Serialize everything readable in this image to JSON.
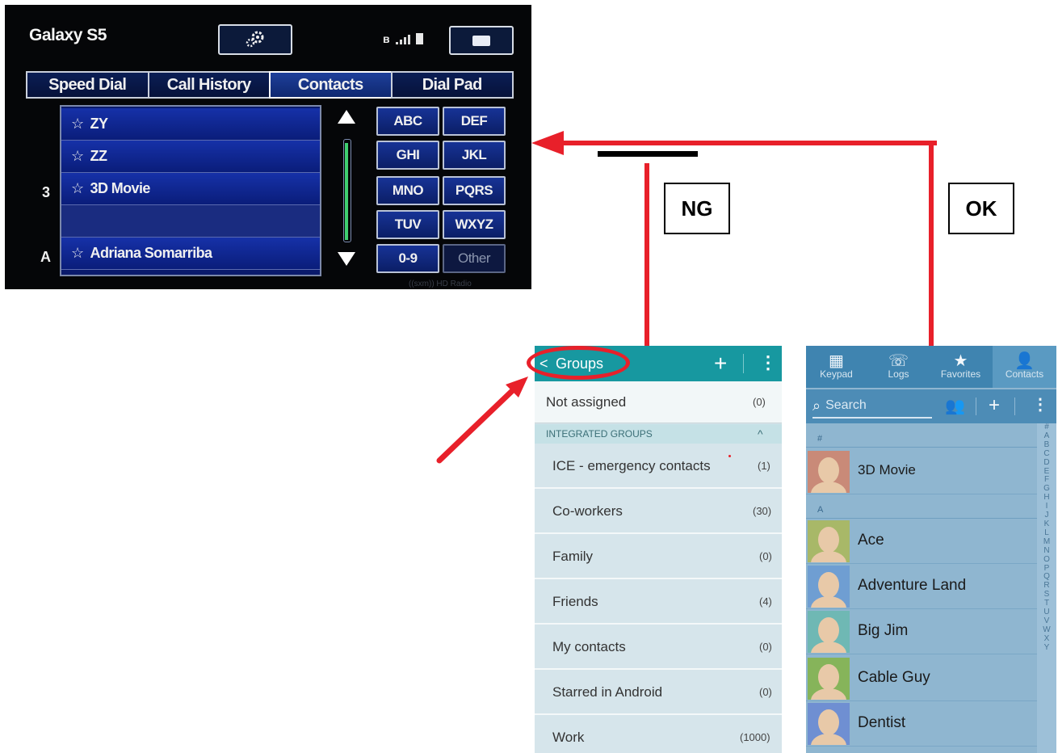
{
  "car_display": {
    "device_name": "Galaxy S5",
    "settings_icon": "gear-icon",
    "status_icons": [
      "bluetooth-icon",
      "signal-bars-icon",
      "battery-icon"
    ],
    "bluetooth_glyph": "ʙ",
    "message_icon": "envelope-icon",
    "tabs": [
      {
        "label": "Speed Dial",
        "active": false
      },
      {
        "label": "Call History",
        "active": false
      },
      {
        "label": "Contacts",
        "active": true
      },
      {
        "label": "Dial Pad",
        "active": false
      }
    ],
    "contact_list": [
      {
        "index": "",
        "star": "☆",
        "name": "ZY"
      },
      {
        "index": "",
        "star": "☆",
        "name": "ZZ"
      },
      {
        "index": "3",
        "star": "☆",
        "name": "3D Movie"
      },
      {
        "index": "",
        "star": "",
        "name": ""
      },
      {
        "index": "A",
        "star": "☆",
        "name": "Adriana Somarriba"
      }
    ],
    "scroll_arrows": [
      "triangle-up-icon",
      "triangle-down-icon"
    ],
    "keypad": [
      [
        "ABC",
        "DEF"
      ],
      [
        "GHI",
        "JKL"
      ],
      [
        "MNO",
        "PQRS"
      ],
      [
        "TUV",
        "WXYZ"
      ],
      [
        "0-9",
        "Other"
      ]
    ],
    "brand_footer": "((sxm)) HD Radio"
  },
  "annotations": {
    "ng_label": "NG",
    "ok_label": "OK",
    "line_color": "#e8202a"
  },
  "groups_screen": {
    "back_glyph": "<",
    "title": "Groups",
    "add_glyph": "+",
    "more_glyph": "⋮",
    "not_assigned": {
      "name": "Not assigned",
      "count": "(0)"
    },
    "section_title": "INTEGRATED GROUPS",
    "section_chevron": "^",
    "groups": [
      {
        "name": "ICE - emergency contacts",
        "count": "(1)"
      },
      {
        "name": "Co-workers",
        "count": "(30)"
      },
      {
        "name": "Family",
        "count": "(0)"
      },
      {
        "name": "Friends",
        "count": "(4)"
      },
      {
        "name": "My contacts",
        "count": "(0)"
      },
      {
        "name": "Starred in Android",
        "count": "(0)"
      },
      {
        "name": "Work",
        "count": "(1000)"
      }
    ]
  },
  "contacts_screen": {
    "tabs": [
      {
        "label": "Keypad",
        "icon": "keypad-icon",
        "glyph": "▦",
        "active": false
      },
      {
        "label": "Logs",
        "icon": "call-log-icon",
        "glyph": "☏",
        "active": false
      },
      {
        "label": "Favorites",
        "icon": "star-icon",
        "glyph": "★",
        "active": false
      },
      {
        "label": "Contacts",
        "icon": "person-icon",
        "glyph": "👤",
        "active": true
      }
    ],
    "search_placeholder": "Search",
    "search_glyph": "⌕",
    "group_glyph": "👥",
    "add_glyph": "+",
    "more_glyph": "⋮",
    "section_hash": "#",
    "section_a": "A",
    "contacts": [
      {
        "name": "3D Movie",
        "avatar_color": "#c98a78"
      },
      {
        "name": "Ace",
        "avatar_color": "#a8b868"
      },
      {
        "name": "Adventure Land",
        "avatar_color": "#6f9ed2"
      },
      {
        "name": "Big Jim",
        "avatar_color": "#6fb8b4"
      },
      {
        "name": "Cable Guy",
        "avatar_color": "#86b45a"
      },
      {
        "name": "Dentist",
        "avatar_color": "#6f8fd2"
      }
    ],
    "alphabet": [
      "#",
      "A",
      "B",
      "C",
      "D",
      "E",
      "F",
      "G",
      "H",
      "I",
      "J",
      "K",
      "L",
      "M",
      "N",
      "O",
      "P",
      "Q",
      "R",
      "S",
      "T",
      "U",
      "V",
      "W",
      "X",
      "Y"
    ]
  }
}
